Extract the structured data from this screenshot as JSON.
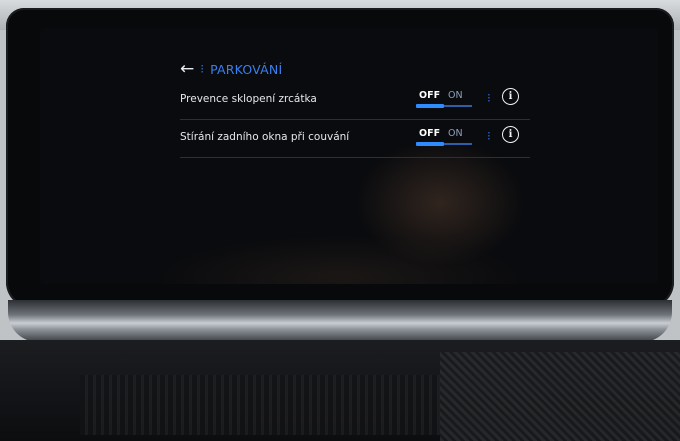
{
  "header": {
    "back_icon": "arrow-left-icon",
    "dots": "⁝",
    "title": "PARKOVÁNÍ"
  },
  "settings": [
    {
      "label": "Prevence sklopení zrcátka",
      "off_label": "OFF",
      "on_label": "ON",
      "state": "OFF",
      "dots": "⁝",
      "info_symbol": "i"
    },
    {
      "label": "Stírání zadního okna při couvání",
      "off_label": "OFF",
      "on_label": "ON",
      "state": "OFF",
      "dots": "⁝",
      "info_symbol": "i"
    }
  ],
  "colors": {
    "accent": "#2f8cff",
    "title": "#3a7ff0",
    "text": "#e6e8ec",
    "screen_bg": "#0a0b0e"
  }
}
